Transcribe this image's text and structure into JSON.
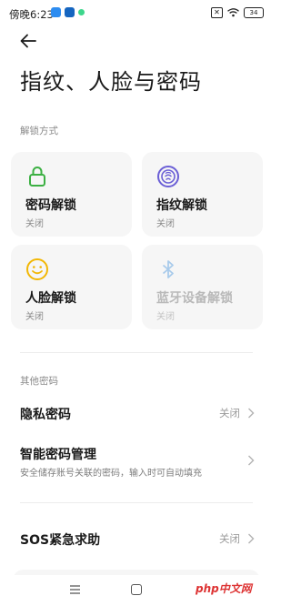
{
  "status_bar": {
    "time": "傍晚6:23",
    "battery": "34"
  },
  "page": {
    "title": "指纹、人脸与密码"
  },
  "unlock_section": {
    "label": "解锁方式",
    "cards": [
      {
        "title": "密码解锁",
        "status": "关闭",
        "icon": "lock-icon",
        "color": "#3cb043"
      },
      {
        "title": "指纹解锁",
        "status": "关闭",
        "icon": "fingerprint-icon",
        "color": "#6b5fd6"
      },
      {
        "title": "人脸解锁",
        "status": "关闭",
        "icon": "face-icon",
        "color": "#f2b705"
      },
      {
        "title": "蓝牙设备解锁",
        "status": "关闭",
        "icon": "bluetooth-icon",
        "color": "#a9cbeb"
      }
    ]
  },
  "other_section": {
    "label": "其他密码",
    "items": [
      {
        "title": "隐私密码",
        "value": "关闭"
      },
      {
        "title": "智能密码管理",
        "subtitle": "安全储存账号关联的密码，输入时可自动填充"
      }
    ]
  },
  "sos": {
    "title": "SOS紧急求助",
    "value": "关闭"
  },
  "watermark": "php中文网"
}
